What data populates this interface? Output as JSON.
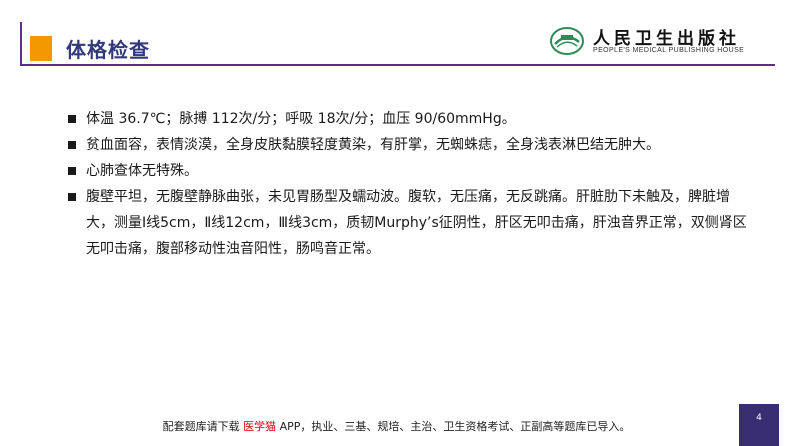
{
  "header": {
    "title": "体格检查",
    "logo_cn": "人民卫生出版社",
    "logo_en": "PEOPLE'S MEDICAL PUBLISHING HOUSE"
  },
  "content": {
    "items": [
      "体温 36.7℃；脉搏 112次/分；呼吸 18次/分；血压 90/60mmHg。",
      "贫血面容，表情淡漠，全身皮肤黏膜轻度黄染，有肝掌，无蜘蛛痣，全身浅表淋巴结无肿大。",
      "心肺查体无特殊。",
      "腹壁平坦，无腹壁静脉曲张，未见胃肠型及蠕动波。腹软，无压痛，无反跳痛。肝脏肋下未触及，脾脏增大，测量Ⅰ线5cm，Ⅱ线12cm，Ⅲ线3cm，质韧Murphy’s征阴性，肝区无叩击痛，肝浊音界正常，双侧肾区无叩击痛，腹部移动性浊音阳性，肠鸣音正常。"
    ]
  },
  "footer": {
    "text_before": "配套题库请下载 ",
    "brand": "医学猫",
    "text_after": " APP，执业、三基、规培、主治、卫生资格考试、正副高等题库已导入。"
  },
  "page_number": "4",
  "colors": {
    "accent_orange": "#f39800",
    "title_blue": "#333a7a",
    "line_purple": "#5c2d8f",
    "brand_red": "#e60012",
    "page_box": "#3a2e73"
  }
}
